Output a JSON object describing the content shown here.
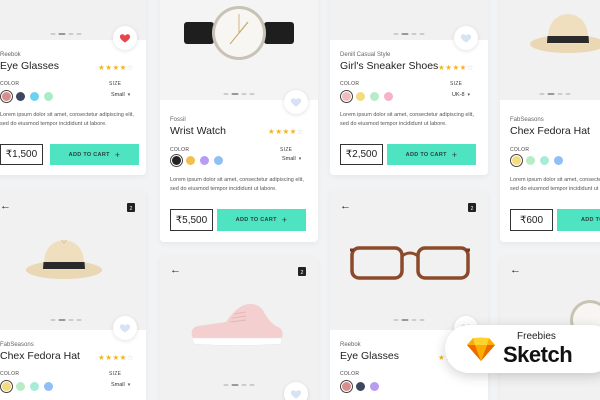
{
  "colors": {
    "accent": "#4ee4c2",
    "star": "#f6b619",
    "heart_active": "#e8454f",
    "heart_inactive": "#d6e3f4"
  },
  "common": {
    "color_label": "COLOR",
    "size_label": "SIZE",
    "add_to_cart": "ADD TO CART",
    "description": "Lorem ipsum dolor sit amet, consectetur adipiscing elit, sed do eiusmod tempor incididunt ut labore."
  },
  "cards": {
    "eye_glasses_top": {
      "brand": "Reebok",
      "title": "Eye Glasses",
      "rating": 4,
      "size_value": "Small",
      "price": "₹1,500",
      "favorited": true,
      "swatch_colors": [
        "#d98e8e",
        "#3f4660",
        "#6cd2f0",
        "#a8ecc8"
      ]
    },
    "wrist_watch": {
      "brand": "Fossil",
      "title": "Wrist Watch",
      "rating": 4,
      "size_value": "Small",
      "price": "₹5,500",
      "favorited": false,
      "swatch_colors": [
        "#222222",
        "#f1bf4d",
        "#b79cf2",
        "#8fbff4"
      ]
    },
    "sneaker_shoes": {
      "brand": "Denill Casual Style",
      "title": "Girl's Sneaker Shoes",
      "rating": 4,
      "size_value": "UK-8",
      "price": "₹2,500",
      "favorited": false,
      "swatch_colors": [
        "#f0bdbd",
        "#f3dc7e",
        "#b8ecc6",
        "#f7b2c5"
      ]
    },
    "fedora_top": {
      "brand": "FabSeasons",
      "title": "Chex Fedora Hat",
      "rating": 4,
      "price": "₹600",
      "favorited": false,
      "swatch_colors": [
        "#f3dc7e",
        "#b8ecc6",
        "#a8ecd8",
        "#8fbff4"
      ]
    },
    "fedora_bottom": {
      "brand": "FabSeasons",
      "title": "Chex Fedora Hat",
      "rating": 4,
      "size_value": "Small",
      "favorited": false,
      "swatch_colors": [
        "#f3dc7e",
        "#b8ecc6",
        "#a8ecd8",
        "#8fbff4"
      ]
    },
    "eye_glasses_bottom": {
      "brand": "Reebok",
      "title": "Eye Glasses",
      "rating": 4,
      "favorited": false,
      "swatch_colors": [
        "#d98e8e",
        "#3f4660",
        "#b79cf2"
      ]
    }
  },
  "badge": {
    "freebies": "Freebies",
    "brand": "Sketch"
  }
}
